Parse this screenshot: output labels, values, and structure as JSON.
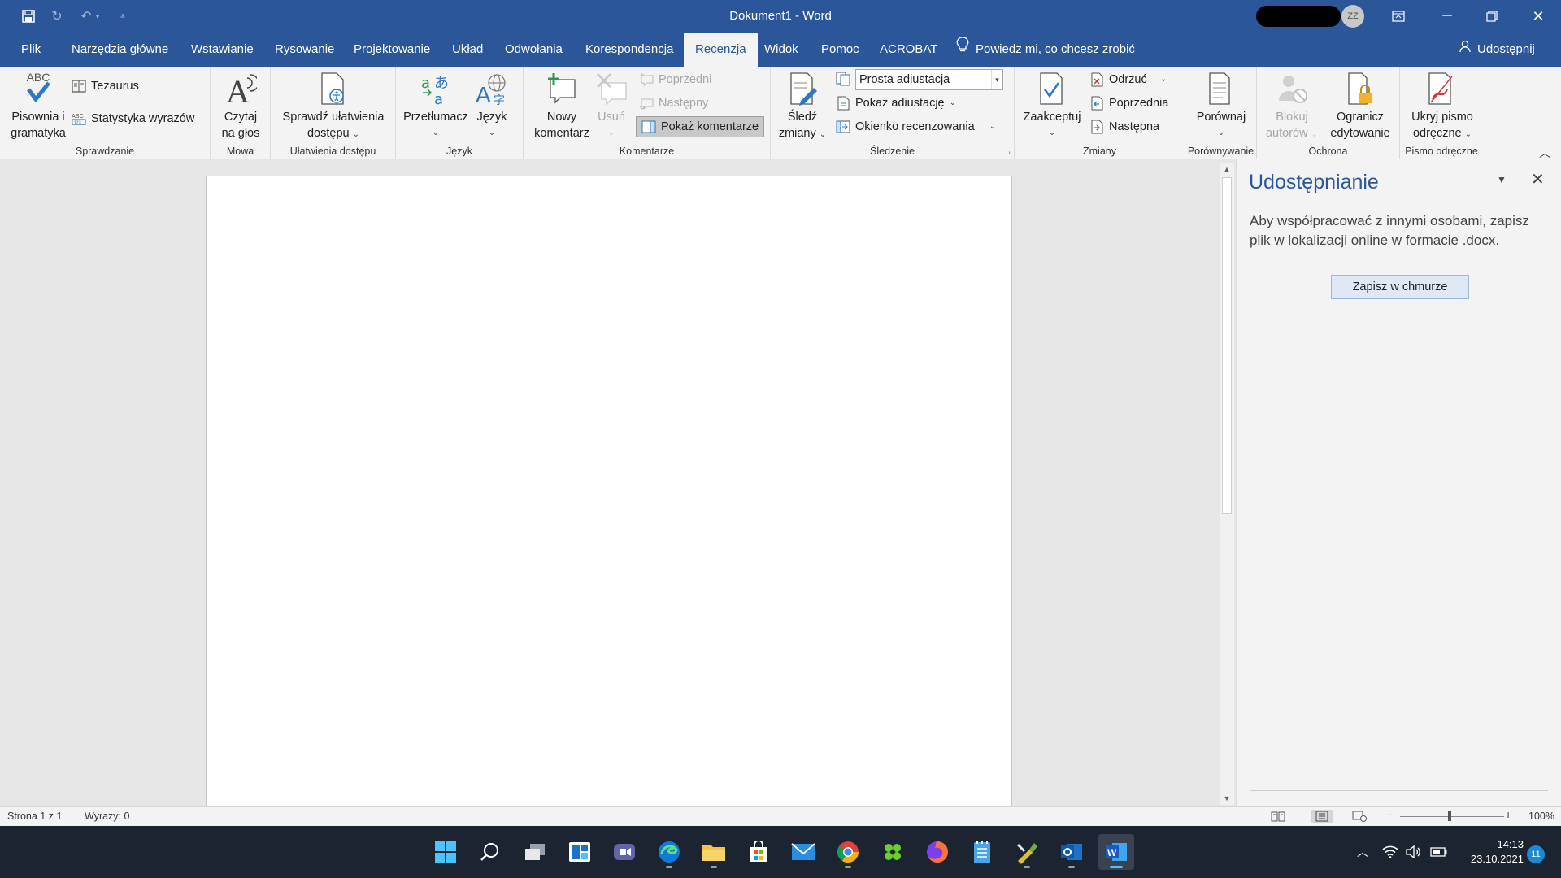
{
  "window": {
    "title": "Dokument1  -  Word",
    "avatar_initials": "ZZ"
  },
  "tabs": [
    {
      "label": "Plik"
    },
    {
      "label": "Narzędzia główne"
    },
    {
      "label": "Wstawianie"
    },
    {
      "label": "Rysowanie"
    },
    {
      "label": "Projektowanie"
    },
    {
      "label": "Układ"
    },
    {
      "label": "Odwołania"
    },
    {
      "label": "Korespondencja"
    },
    {
      "label": "Recenzja",
      "active": true
    },
    {
      "label": "Widok"
    },
    {
      "label": "Pomoc"
    },
    {
      "label": "ACROBAT"
    }
  ],
  "tell_me": "Powiedz mi, co chcesz zrobić",
  "share_label": "Udostępnij",
  "ribbon": {
    "sprawdzanie": {
      "label": "Sprawdzanie",
      "spelling_line1": "Pisownia i",
      "spelling_line2": "gramatyka",
      "abc_text": "ABC",
      "thesaurus": "Tezaurus",
      "word_count": "Statystyka wyrazów"
    },
    "mowa": {
      "label": "Mowa",
      "read_line1": "Czytaj",
      "read_line2": "na głos"
    },
    "dostepnosc": {
      "label": "Ułatwienia dostępu",
      "check_line1": "Sprawdź ułatwienia",
      "check_line2": "dostępu"
    },
    "jezyk": {
      "label": "Język",
      "translate": "Przetłumacz",
      "language": "Język"
    },
    "komentarze": {
      "label": "Komentarze",
      "new_line1": "Nowy",
      "new_line2": "komentarz",
      "delete": "Usuń",
      "previous": "Poprzedni",
      "next": "Następny",
      "show": "Pokaż komentarze"
    },
    "sledzenie": {
      "label": "Śledzenie",
      "track_line1": "Śledź",
      "track_line2": "zmiany",
      "markup_value": "Prosta adiustacja",
      "show_markup": "Pokaż adiustację",
      "review_pane": "Okienko recenzowania"
    },
    "zmiany": {
      "label": "Zmiany",
      "accept": "Zaakceptuj",
      "reject": "Odrzuć",
      "previous": "Poprzednia",
      "next": "Następna"
    },
    "porownywanie": {
      "label": "Porównywanie",
      "compare": "Porównaj"
    },
    "ochrona": {
      "label": "Ochrona",
      "block_line1": "Blokuj",
      "block_line2": "autorów",
      "restrict_line1": "Ogranicz",
      "restrict_line2": "edytowanie"
    },
    "pismo": {
      "label": "Pismo odręczne",
      "hide_line1": "Ukryj pismo",
      "hide_line2": "odręczne"
    }
  },
  "pane": {
    "title": "Udostępnianie",
    "description": "Aby współpracować z innymi osobami, zapisz plik w lokalizacji online w formacie .docx.",
    "button": "Zapisz w chmurze"
  },
  "status": {
    "page": "Strona 1 z 1",
    "words": "Wyrazy: 0",
    "zoom": "100%",
    "zoom_minus": "−",
    "zoom_plus": "+"
  },
  "taskbar": {
    "time": "14:13",
    "date": "23.10.2021",
    "notifications": "11"
  },
  "colors": {
    "word_blue": "#2b579a",
    "taskbar": "#1c2331",
    "accent": "#4cc2ff"
  }
}
